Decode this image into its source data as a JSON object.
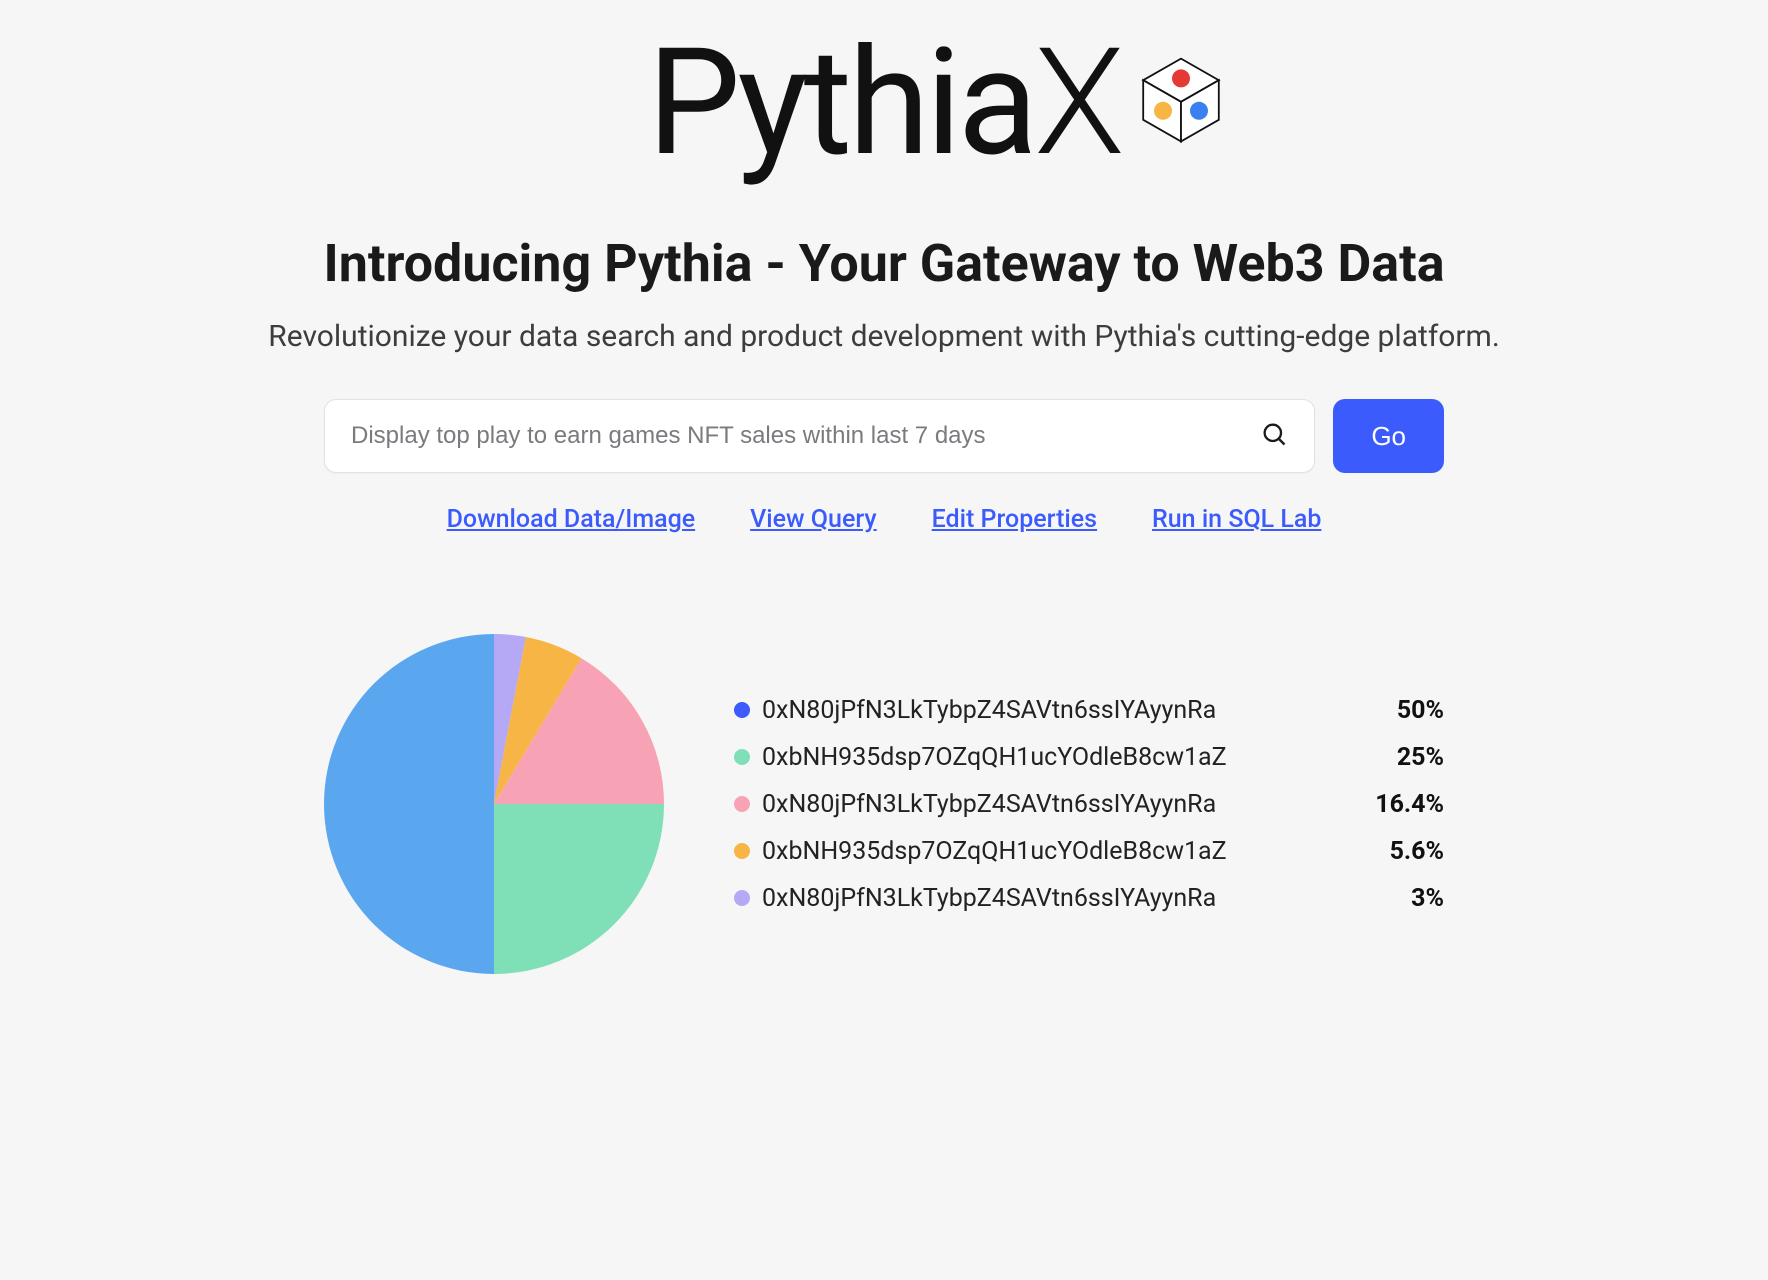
{
  "brand": {
    "name_main": "Pythia",
    "name_suffix": "X"
  },
  "hero": {
    "headline": "Introducing Pythia - Your Gateway to Web3 Data",
    "subhead": "Revolutionize your data search and product development with Pythia's cutting-edge platform."
  },
  "search": {
    "placeholder": "Display top play to earn games NFT sales within last 7 days",
    "button": "Go"
  },
  "links": {
    "download": "Download Data/Image",
    "view_query": "View Query",
    "edit_props": "Edit Properties",
    "run_sql": "Run in SQL Lab"
  },
  "chart_data": {
    "type": "pie",
    "title": "",
    "series": [
      {
        "label": "0xN80jPfN3LkTybpZ4SAVtn6ssIYAyynRa",
        "value": 50,
        "pct": "50%",
        "color": "#5aa7f0"
      },
      {
        "label": "0xbNH935dsp7OZqQH1ucYOdleB8cw1aZ",
        "value": 25,
        "pct": "25%",
        "color": "#7fe0b8"
      },
      {
        "label": "0xN80jPfN3LkTybpZ4SAVtn6ssIYAyynRa",
        "value": 16.4,
        "pct": "16.4%",
        "color": "#f7a3b5"
      },
      {
        "label": "0xbNH935dsp7OZqQH1ucYOdleB8cw1aZ",
        "value": 5.6,
        "pct": "5.6%",
        "color": "#f6b545"
      },
      {
        "label": "0xN80jPfN3LkTybpZ4SAVtn6ssIYAyynRa",
        "value": 3,
        "pct": "3%",
        "color": "#b5a8f4"
      }
    ],
    "legend_colors": {
      "0": "#3b5bfc",
      "1": "#7fe0b8",
      "2": "#f7a3b5",
      "3": "#f6b545",
      "4": "#b5a8f4"
    }
  },
  "colors": {
    "accent": "#3b5bfc",
    "bg": "#f6f6f7"
  }
}
